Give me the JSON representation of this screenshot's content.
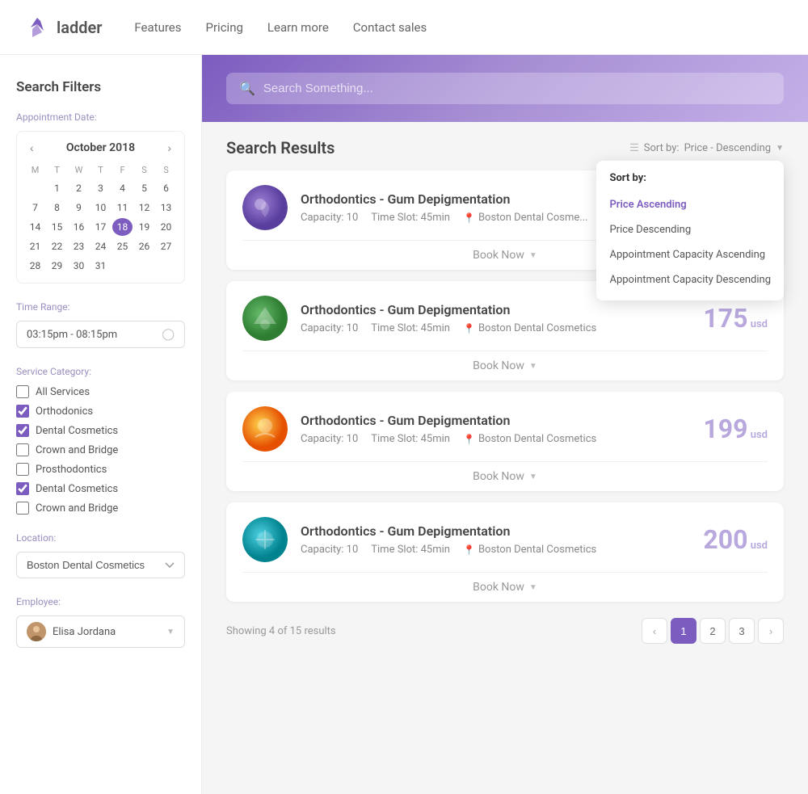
{
  "navbar": {
    "logo_text": "ladder",
    "links": [
      {
        "label": "Features"
      },
      {
        "label": "Pricing"
      },
      {
        "label": "Learn more"
      },
      {
        "label": "Contact sales"
      }
    ]
  },
  "sidebar": {
    "title": "Search Filters",
    "appointment_date_label": "Appointment Date:",
    "calendar": {
      "month": "October 2018",
      "day_headers": [
        "M",
        "T",
        "W",
        "T",
        "F",
        "S",
        "S"
      ],
      "weeks": [
        [
          "",
          "",
          "",
          "",
          "",
          "",
          "1"
        ],
        [
          "",
          "",
          "2",
          "3",
          "4",
          "5",
          "6",
          "7"
        ],
        [
          "8",
          "9",
          "10",
          "11",
          "12",
          "13",
          "14"
        ],
        [
          "15",
          "16",
          "17",
          "18",
          "19",
          "20",
          "21"
        ],
        [
          "22",
          "23",
          "24",
          "25",
          "26",
          "27",
          "28"
        ],
        [
          "29",
          "30",
          "31",
          "",
          "",
          "",
          ""
        ]
      ],
      "selected_day": "18"
    },
    "time_range_label": "Time Range:",
    "time_range_value": "03:15pm - 08:15pm",
    "service_category_label": "Service Category:",
    "services": [
      {
        "label": "All Services",
        "checked": false
      },
      {
        "label": "Orthodonics",
        "checked": true
      },
      {
        "label": "Dental Cosmetics",
        "checked": true
      },
      {
        "label": "Crown and Bridge",
        "checked": false
      },
      {
        "label": "Prosthodontics",
        "checked": false
      },
      {
        "label": "Dental Cosmetics",
        "checked": true
      },
      {
        "label": "Crown and Bridge",
        "checked": false
      }
    ],
    "location_label": "Location:",
    "location_value": "Boston Dental Cosmetics",
    "employee_label": "Employee:",
    "employee_name": "Elisa Jordana"
  },
  "search": {
    "placeholder": "Search Something...",
    "header_gradient": "linear-gradient(135deg, #7c5cbf, #a78fd4, #c4b0e8)"
  },
  "results": {
    "title": "Search Results",
    "sort_label": "Sort by:",
    "sort_value": "Price - Descending",
    "sort_dropdown": {
      "title": "Sort by:",
      "options": [
        {
          "label": "Price Ascending",
          "active": false
        },
        {
          "label": "Price Descending",
          "active": false
        },
        {
          "label": "Appointment Capacity Ascending",
          "active": false
        },
        {
          "label": "Appointment Capacity Descending",
          "active": false
        }
      ]
    },
    "cards": [
      {
        "id": 1,
        "title": "Orthodontics - Gum Depigmentation",
        "capacity": "Capacity: 10",
        "time_slot": "Time Slot: 45min",
        "location": "Boston Dental Cosme...",
        "price": null,
        "price_usd": null,
        "icon_bg": "radial-gradient(circle at 40% 40%, #7c5cbf, #5a3e9e)",
        "book_label": "Book Now"
      },
      {
        "id": 2,
        "title": "Orthodontics - Gum Depigmentation",
        "capacity": "Capacity: 10",
        "time_slot": "Time Slot: 45min",
        "location": "Boston Dental Cosmetics",
        "price": "175",
        "price_usd": "usd",
        "icon_bg": "radial-gradient(circle at 40% 40%, #4caf50, #2e7d32)",
        "book_label": "Book Now"
      },
      {
        "id": 3,
        "title": "Orthodontics - Gum Depigmentation",
        "capacity": "Capacity: 10",
        "time_slot": "Time Slot: 45min",
        "location": "Boston Dental Cosmetics",
        "price": "199",
        "price_usd": "usd",
        "icon_bg": "radial-gradient(circle at 40% 40%, #ffc107, #e65100)",
        "book_label": "Book Now"
      },
      {
        "id": 4,
        "title": "Orthodontics - Gum Depigmentation",
        "capacity": "Capacity: 10",
        "time_slot": "Time Slot: 45min",
        "location": "Boston Dental Cosmetics",
        "price": "200",
        "price_usd": "usd",
        "icon_bg": "radial-gradient(circle at 40% 40%, #26c6da, #00838f)",
        "book_label": "Book Now"
      }
    ],
    "showing_text": "Showing 4 of 15 results",
    "pagination": {
      "current": 1,
      "pages": [
        "1",
        "2",
        "3"
      ]
    }
  }
}
